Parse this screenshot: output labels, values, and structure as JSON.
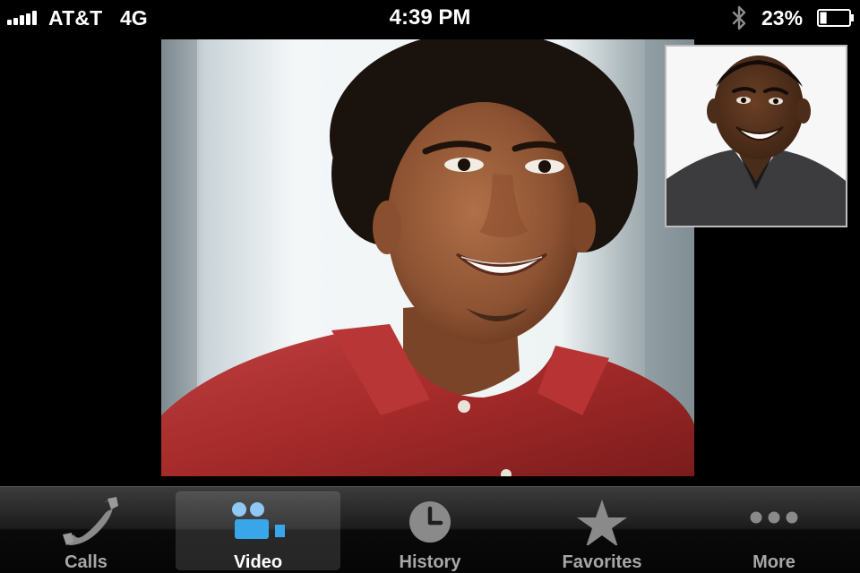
{
  "status_bar": {
    "carrier": "AT&T",
    "network": "4G",
    "time": "4:39 PM",
    "battery_percent": "23%",
    "battery_level": 0.23,
    "signal_bars": 5,
    "icons": [
      "signal-bars-icon",
      "bluetooth-icon",
      "battery-icon"
    ]
  },
  "video_call": {
    "remote_feed_icon": "remote-participant-video",
    "self_preview_icon": "self-camera-preview"
  },
  "tab_bar": {
    "active": "video",
    "tabs": [
      {
        "id": "calls",
        "label": "Calls",
        "icon": "phone-icon"
      },
      {
        "id": "video",
        "label": "Video",
        "icon": "video-camera-icon"
      },
      {
        "id": "history",
        "label": "History",
        "icon": "clock-icon"
      },
      {
        "id": "favorites",
        "label": "Favorites",
        "icon": "star-icon"
      },
      {
        "id": "more",
        "label": "More",
        "icon": "more-dots-icon"
      }
    ]
  },
  "colors": {
    "active_tab_icon": "#3aa6ea",
    "inactive_tab_icon": "#8a8a8a",
    "active_label": "#ffffff",
    "inactive_label": "#a7a7a7"
  }
}
